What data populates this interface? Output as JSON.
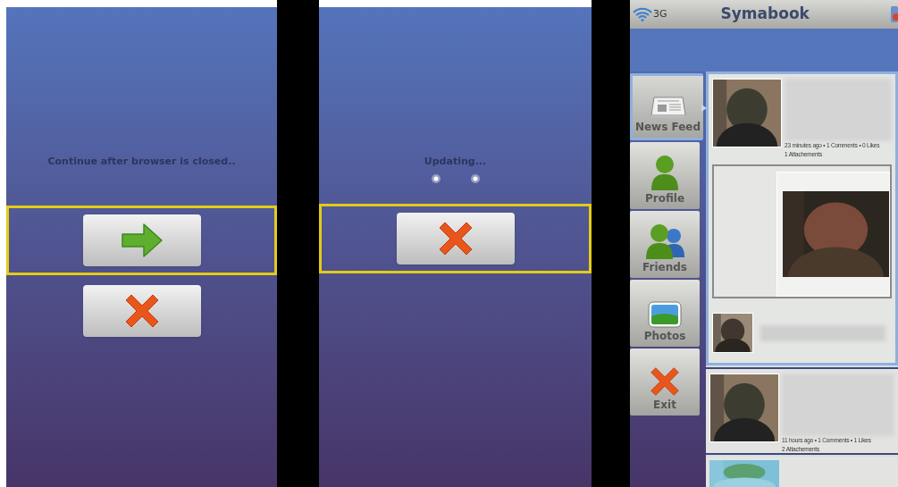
{
  "browser_wait_screen": {
    "message": "Continue after browser is closed..",
    "buttons": [
      {
        "kind": "next",
        "selected": true
      },
      {
        "kind": "cancel",
        "selected": false
      }
    ]
  },
  "updating_screen": {
    "message": "Updating...",
    "buttons": [
      {
        "kind": "cancel",
        "selected": true
      }
    ]
  },
  "app_screen": {
    "status_bar": {
      "network": "3G"
    },
    "title": "Symabook",
    "nav_items": [
      {
        "kind": "news",
        "label": "News Feed",
        "selected": true
      },
      {
        "kind": "profile",
        "label": "Profile",
        "selected": false
      },
      {
        "kind": "friends",
        "label": "Friends",
        "selected": false
      },
      {
        "kind": "photos",
        "label": "Photos",
        "selected": false
      },
      {
        "kind": "exit",
        "label": "Exit",
        "selected": false
      }
    ],
    "posts": [
      {
        "meta": "23 minutes ago • 1 Comments • 0 Likes",
        "attachments": "1 Attachements",
        "expanded": true
      },
      {
        "meta": "11 hours ago • 1 Comments • 1 Likes",
        "attachments": "2 Attachements",
        "expanded": false
      }
    ]
  }
}
